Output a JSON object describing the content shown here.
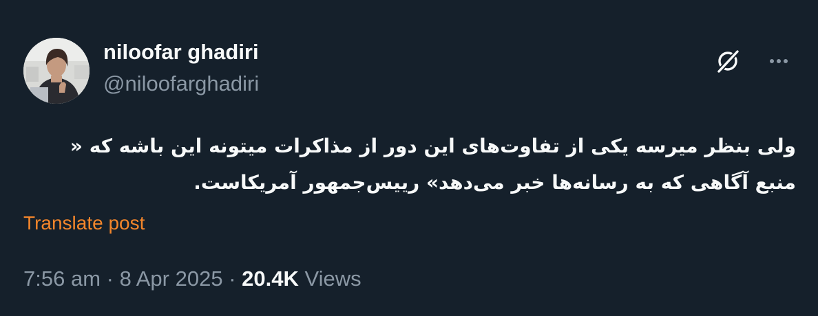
{
  "author": {
    "display_name": "niloofar ghadiri",
    "handle": "@niloofarghadiri",
    "avatar_icon": "profile-photo"
  },
  "actions": {
    "grok_icon": "grok-icon",
    "more_icon": "more-dots-icon"
  },
  "post": {
    "text": "ولی بنظر میرسه یکی از تفاوت‌های این دور از مذاکرات میتونه این باشه که « منبع آگاهی که به رسانه‌ها خبر می‌دهد» رییس‌جمهور آمریکاست.",
    "translate_label": "Translate post"
  },
  "meta": {
    "time": "7:56 am",
    "separator": "·",
    "date": "8 Apr 2025",
    "views_count": "20.4K",
    "views_label": "Views"
  },
  "colors": {
    "background": "#15202b",
    "primary_text": "#f7f9f9",
    "secondary_text": "#8b98a5",
    "translate_accent": "#f4862b"
  }
}
